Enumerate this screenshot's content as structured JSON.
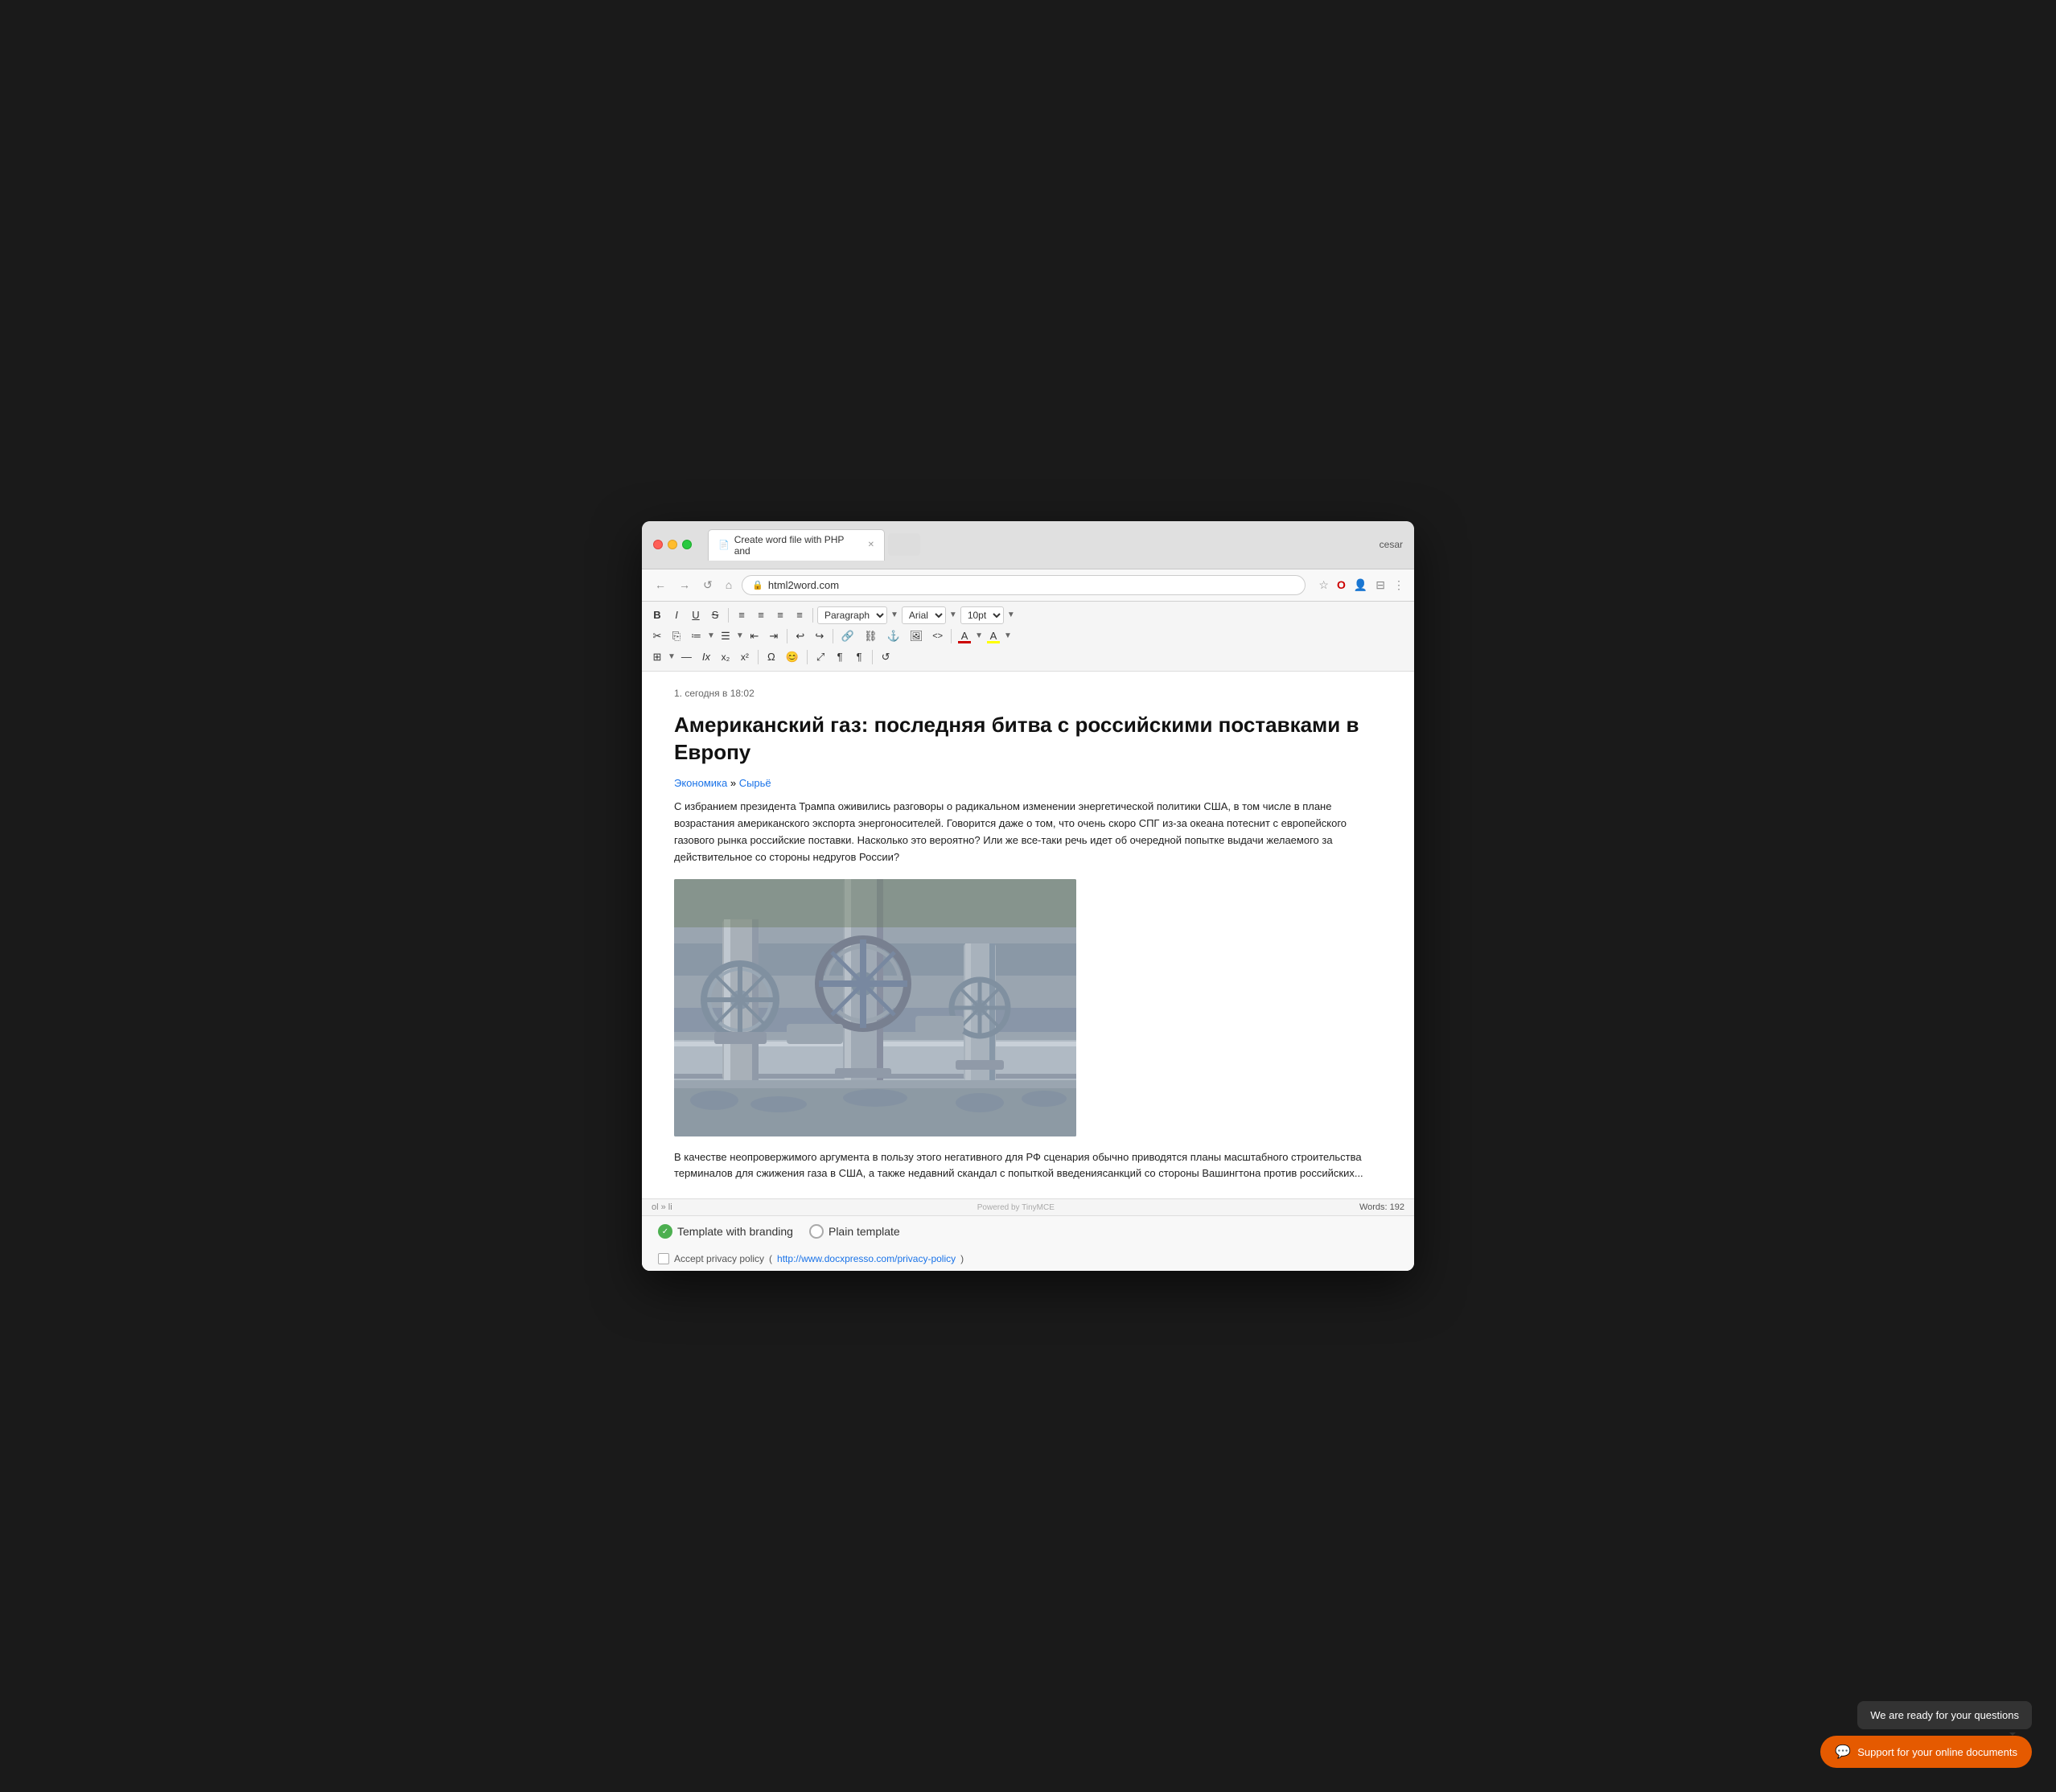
{
  "window": {
    "user": "cesar"
  },
  "tab": {
    "title": "Create word file with PHP and",
    "favicon": "📄"
  },
  "address_bar": {
    "url": "html2word.com",
    "back_label": "←",
    "forward_label": "→",
    "reload_label": "↺",
    "home_label": "⌂"
  },
  "toolbar": {
    "row1": {
      "bold": "B",
      "italic": "I",
      "underline": "U",
      "strikethrough": "S",
      "align_left": "≡",
      "align_center": "≡",
      "align_right": "≡",
      "align_justify": "≡",
      "paragraph_select": "Paragraph",
      "font_select": "Arial",
      "size_select": "10pt"
    },
    "row2": {
      "cut": "✂",
      "copy": "⎘",
      "unordered_list": "☰",
      "ordered_list": "☰",
      "outdent": "⇤",
      "indent": "⇥",
      "undo": "↩",
      "redo": "↪",
      "link": "🔗",
      "unlink": "🚫",
      "anchor": "⚓",
      "image": "🖼",
      "code": "<>",
      "text_color": "A",
      "bg_color": "A"
    },
    "row3": {
      "table": "⊞",
      "hr": "—",
      "clear": "Ix",
      "subscript": "x₂",
      "superscript": "x²",
      "special_char": "Ω",
      "emoji": "😊",
      "fullscreen": "⤢",
      "show_blocks": "¶",
      "direction_ltr": "¶",
      "restore": "↺"
    }
  },
  "editor": {
    "meta": "1. сегодня в 18:02",
    "title": "Американский газ: последняя битва с российскими поставками в Европу",
    "category1": "Экономика",
    "separator": "»",
    "category2": "Сырьё",
    "body_text": "С избранием президента Трампа оживились разговоры о радикальном изменении энергетической политики США, в том числе в плане возрастания американского экспорта энергоносителей. Говорится даже о том, что очень скоро СПГ из-за океана потеснит с европейского газового рынка российские поставки. Насколько это вероятно? Или же все-таки речь идет об очередной попытке выдачи желаемого за действительное со стороны недругов России?",
    "body_text_bottom": "В качестве неопровержимого аргумента в пользу этого негативного для РФ сценария обычно приводятся планы масштабного строительства терминалов для сжижения газа в США, а также недавний скандал с попыткой введениясанкций со стороны Вашингтона против российских..."
  },
  "status_bar": {
    "breadcrumb": "ol » li",
    "word_count_label": "Words:",
    "word_count": "192",
    "powered_by": "Powered by TinyMCE"
  },
  "bottom": {
    "template_branding_label": "Template with branding",
    "template_plain_label": "Plain template",
    "privacy_label": "Accept privacy policy",
    "privacy_link_text": "http://www.docxpresso.com/privacy-policy",
    "privacy_link": "http://www.docxpresso.com/privacy-policy"
  },
  "chat": {
    "bubble_text": "We are ready for your questions",
    "support_button_label": "Support for your online documents",
    "support_icon": "💬"
  },
  "colors": {
    "accent_orange": "#e55a00",
    "link_blue": "#1a73e8",
    "text_dark": "#111111",
    "bg_light": "#f8f8f8"
  }
}
